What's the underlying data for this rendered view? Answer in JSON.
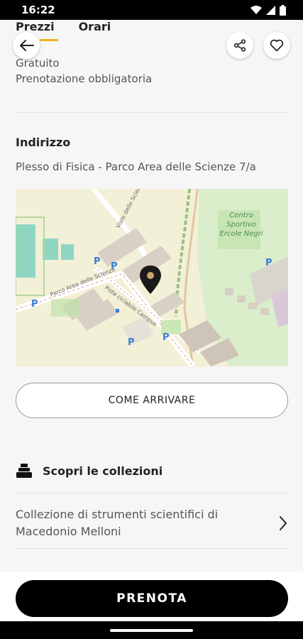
{
  "status_bar": {
    "time": "16:22"
  },
  "tabs": [
    {
      "label": "Prezzi"
    },
    {
      "label": "Orari"
    }
  ],
  "prices": {
    "line1": "Gratuito",
    "line2": "Prenotazione obbligatoria"
  },
  "address_section": {
    "title": "Indirizzo",
    "address": "Plesso di Fisica - Parco Area delle Scienze 7/a"
  },
  "map": {
    "label_centro1": "Centro",
    "label_centro2": "Sportivo",
    "label_centro3": "Ercole Negri",
    "road_viale": "Viale delle Scienze",
    "road_parco": "Parco Area delle Scienze",
    "road_pista": "Pista ciclabile Campus",
    "parking_glyph": "P"
  },
  "route_button": {
    "label": "COME ARRIVARE"
  },
  "collections": {
    "title": "Scopri le collezioni",
    "items": [
      {
        "label": "Collezione di strumenti scientifici di Macedonio Melloni"
      }
    ]
  },
  "book_button": {
    "label": "PRENOTA"
  },
  "colors": {
    "accent": "#f3b01b",
    "primary": "#000000",
    "background": "#f6f6f6"
  },
  "icons": [
    "wifi-icon",
    "signal-icon",
    "battery-icon",
    "back-arrow-icon",
    "share-icon",
    "heart-icon",
    "location-pin-icon",
    "collections-icon",
    "chevron-right-icon"
  ]
}
